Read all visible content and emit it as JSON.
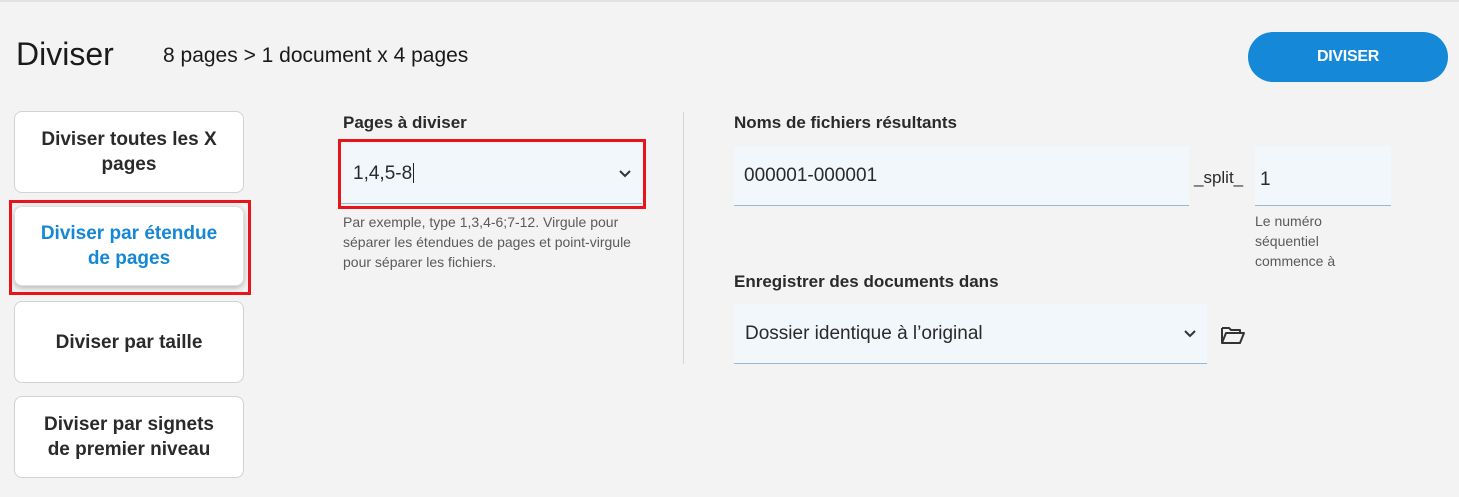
{
  "header": {
    "title": "Diviser",
    "summary": "8 pages > 1 document x 4 pages",
    "action_label": "DIVISER"
  },
  "modes": [
    {
      "label": "Diviser toutes les X pages",
      "active": false
    },
    {
      "label": "Diviser par étendue de pages",
      "active": true
    },
    {
      "label": "Diviser par taille",
      "active": false
    },
    {
      "label": "Diviser par signets de premier niveau",
      "active": false
    }
  ],
  "pages_section": {
    "label": "Pages à diviser",
    "value": "1,4,5-8",
    "helper": "Par exemple, type 1,3,4-6;7-12. Virgule pour séparer les étendues de pages et point-virgule pour séparer les fichiers."
  },
  "output": {
    "filenames_label": "Noms de fichiers résultants",
    "filename_value": "000001-000001",
    "separator_text": "_split_",
    "sequence_value": "1",
    "sequence_helper": "Le numéro séquentiel commence à",
    "save_label": "Enregistrer des documents dans",
    "save_value": "Dossier identique à l’original"
  },
  "colors": {
    "accent": "#1589d8",
    "highlight": "#e8141b",
    "field_bg": "#f1f7fb"
  },
  "icons": {
    "dropdown": "chevron-down-icon",
    "folder": "folder-open-icon"
  }
}
